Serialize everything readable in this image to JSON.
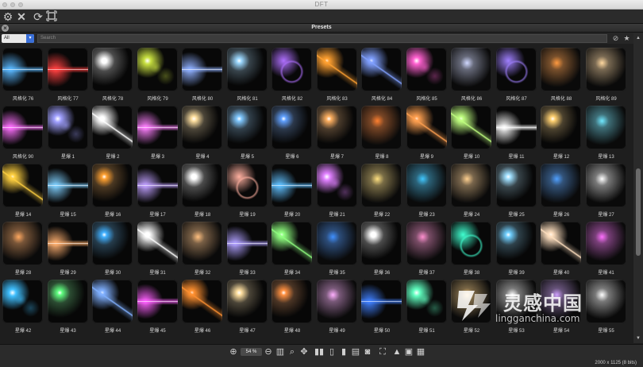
{
  "window": {
    "title": "DFT"
  },
  "panel": {
    "title": "Presets"
  },
  "filter": {
    "selected": "All",
    "search_placeholder": "Search"
  },
  "zoom_value": "54 %",
  "image_info": "2000 x 1125 (8 bits)",
  "watermark": {
    "cn": "灵感中国",
    "en": "lingganchina.com"
  },
  "colors": {
    "accent": "#3a6fd8",
    "background": "#1e1e1e"
  },
  "presets": [
    {
      "label": "风格化 76",
      "color": "#5ab8ff",
      "kind": "streak"
    },
    {
      "label": "风格化 77",
      "color": "#ff4040",
      "kind": "streak"
    },
    {
      "label": "风格化 78",
      "color": "#ffffff",
      "kind": "star"
    },
    {
      "label": "风格化 79",
      "color": "#c8e040",
      "kind": "orbs"
    },
    {
      "label": "风格化 80",
      "color": "#8fb0ff",
      "kind": "streak"
    },
    {
      "label": "风格化 81",
      "color": "#9cd8ff",
      "kind": "star"
    },
    {
      "label": "风格化 82",
      "color": "#b070ff",
      "kind": "ring"
    },
    {
      "label": "风格化 83",
      "color": "#ffa030",
      "kind": "diag"
    },
    {
      "label": "风格化 84",
      "color": "#80a0ff",
      "kind": "diag"
    },
    {
      "label": "风格化 85",
      "color": "#ff60d0",
      "kind": "orbs"
    },
    {
      "label": "风格化 86",
      "color": "#d0d8ff",
      "kind": "glow"
    },
    {
      "label": "风格化 87",
      "color": "#a080ff",
      "kind": "ring"
    },
    {
      "label": "风格化 88",
      "color": "#ff9a40",
      "kind": "glow"
    },
    {
      "label": "风格化 89",
      "color": "#ffd8a0",
      "kind": "glow"
    },
    {
      "label": "风格化 90",
      "color": "#ff70ff",
      "kind": "streak"
    },
    {
      "label": "星爆 1",
      "color": "#a0a0ff",
      "kind": "orbs"
    },
    {
      "label": "星爆 2",
      "color": "#ffffff",
      "kind": "diag"
    },
    {
      "label": "星爆 3",
      "color": "#ff80ff",
      "kind": "streak"
    },
    {
      "label": "星爆 4",
      "color": "#ffe0a0",
      "kind": "star"
    },
    {
      "label": "星爆 5",
      "color": "#80c8ff",
      "kind": "star"
    },
    {
      "label": "星爆 6",
      "color": "#60a0ff",
      "kind": "star"
    },
    {
      "label": "星爆 7",
      "color": "#ffb060",
      "kind": "star"
    },
    {
      "label": "星爆 8",
      "color": "#ff8030",
      "kind": "glow"
    },
    {
      "label": "星爆 9",
      "color": "#ffa050",
      "kind": "diag"
    },
    {
      "label": "星爆 10",
      "color": "#c0ff80",
      "kind": "diag"
    },
    {
      "label": "星爆 11",
      "color": "#ffffff",
      "kind": "streak"
    },
    {
      "label": "星爆 12",
      "color": "#ffd070",
      "kind": "star"
    },
    {
      "label": "星爆 13",
      "color": "#70e8ff",
      "kind": "glow"
    },
    {
      "label": "星爆 14",
      "color": "#ffd040",
      "kind": "diag"
    },
    {
      "label": "星爆 15",
      "color": "#80d0ff",
      "kind": "streak"
    },
    {
      "label": "星爆 16",
      "color": "#ffa030",
      "kind": "star"
    },
    {
      "label": "星爆 17",
      "color": "#c0a0ff",
      "kind": "streak"
    },
    {
      "label": "星爆 18",
      "color": "#ffffff",
      "kind": "star"
    },
    {
      "label": "星爆 19",
      "color": "#ffb0a0",
      "kind": "ring"
    },
    {
      "label": "星爆 20",
      "color": "#60c0ff",
      "kind": "streak"
    },
    {
      "label": "星爆 21",
      "color": "#e080ff",
      "kind": "orbs"
    },
    {
      "label": "星爆 22",
      "color": "#ffe080",
      "kind": "glow"
    },
    {
      "label": "星爆 23",
      "color": "#40c8ff",
      "kind": "glow"
    },
    {
      "label": "星爆 24",
      "color": "#ffd090",
      "kind": "glow"
    },
    {
      "label": "星爆 25",
      "color": "#a0e0ff",
      "kind": "star"
    },
    {
      "label": "星爆 26",
      "color": "#50a0ff",
      "kind": "glow"
    },
    {
      "label": "星爆 27",
      "color": "#ffffff",
      "kind": "glow"
    },
    {
      "label": "星爆 28",
      "color": "#ffa860",
      "kind": "glow"
    },
    {
      "label": "星爆 29",
      "color": "#ffb070",
      "kind": "streak"
    },
    {
      "label": "星爆 30",
      "color": "#40b0ff",
      "kind": "star"
    },
    {
      "label": "星爆 31",
      "color": "#ffffff",
      "kind": "diag"
    },
    {
      "label": "星爆 32",
      "color": "#ffc080",
      "kind": "glow"
    },
    {
      "label": "星爆 33",
      "color": "#b0a0ff",
      "kind": "streak"
    },
    {
      "label": "星爆 34",
      "color": "#90ff80",
      "kind": "diag"
    },
    {
      "label": "星爆 35",
      "color": "#4090ff",
      "kind": "glow"
    },
    {
      "label": "星爆 36",
      "color": "#ffffff",
      "kind": "star"
    },
    {
      "label": "星爆 37",
      "color": "#ff90d0",
      "kind": "glow"
    },
    {
      "label": "星爆 38",
      "color": "#40ffd0",
      "kind": "ring"
    },
    {
      "label": "星爆 39",
      "color": "#70d0ff",
      "kind": "star"
    },
    {
      "label": "星爆 40",
      "color": "#ffe0c0",
      "kind": "diag"
    },
    {
      "label": "星爆 41",
      "color": "#ff70ff",
      "kind": "glow"
    },
    {
      "label": "星爆 42",
      "color": "#40c0ff",
      "kind": "orbs"
    },
    {
      "label": "星爆 43",
      "color": "#60ff80",
      "kind": "star"
    },
    {
      "label": "星爆 44",
      "color": "#80b0ff",
      "kind": "diag"
    },
    {
      "label": "星爆 45",
      "color": "#ff60ff",
      "kind": "streak"
    },
    {
      "label": "星爆 46",
      "color": "#ff9030",
      "kind": "diag"
    },
    {
      "label": "星爆 47",
      "color": "#ffe0a0",
      "kind": "star"
    },
    {
      "label": "星爆 48",
      "color": "#ff9040",
      "kind": "star"
    },
    {
      "label": "星爆 49",
      "color": "#ffb0ff",
      "kind": "glow"
    },
    {
      "label": "星爆 50",
      "color": "#4080ff",
      "kind": "streak"
    },
    {
      "label": "星爆 51",
      "color": "#60ffc0",
      "kind": "orbs"
    },
    {
      "label": "星爆 52",
      "color": "#ffd080",
      "kind": "glow"
    },
    {
      "label": "星爆 53",
      "color": "#ffffff",
      "kind": "glow"
    },
    {
      "label": "星爆 54",
      "color": "#d0a0ff",
      "kind": "glow"
    },
    {
      "label": "星爆 55",
      "color": "#ffffff",
      "kind": "glow"
    }
  ]
}
